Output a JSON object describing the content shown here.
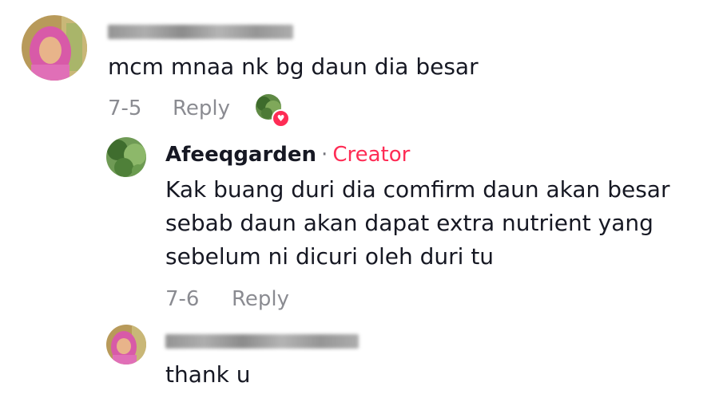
{
  "comments": [
    {
      "text": "mcm mnaa nk bg daun dia besar",
      "date": "7-5",
      "reply_label": "Reply"
    }
  ],
  "replies": [
    {
      "username": "Afeeqgarden",
      "separator": "·",
      "badge": "Creator",
      "text_lines": [
        "Kak buang duri dia comfirm daun akan besar",
        "sebab daun akan dapat extra nutrient yang",
        "sebelum ni dicuri oleh duri tu"
      ],
      "date": "7-6",
      "reply_label": "Reply"
    },
    {
      "text": "thank u"
    }
  ],
  "icons": {
    "liked_by_creator": "heart-icon"
  },
  "colors": {
    "accent": "#fe2c55",
    "muted": "#8a8b91",
    "text": "#161823"
  }
}
